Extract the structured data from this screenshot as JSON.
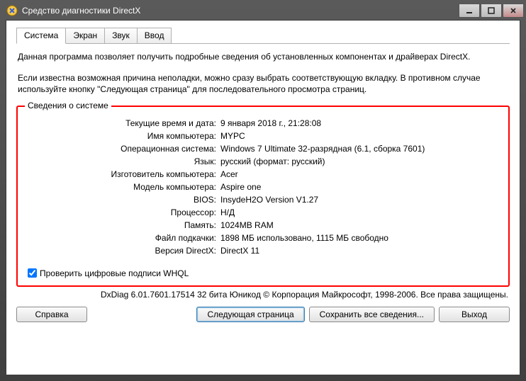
{
  "window": {
    "title": "Средство диагностики DirectX"
  },
  "tabs": [
    "Система",
    "Экран",
    "Звук",
    "Ввод"
  ],
  "intro": {
    "p1": "Данная программа позволяет получить подробные сведения об установленных компонентах и драйверах DirectX.",
    "p2": "Если известна возможная причина неполадки, можно сразу выбрать соответствующую вкладку. В противном случае используйте кнопку \"Следующая страница\" для последовательного просмотра страниц."
  },
  "system_info": {
    "legend": "Сведения о системе",
    "rows": [
      {
        "label": "Текущие время и дата:",
        "value": "9 января 2018 г., 21:28:08"
      },
      {
        "label": "Имя компьютера:",
        "value": "MYPC"
      },
      {
        "label": "Операционная система:",
        "value": "Windows 7 Ultimate 32-разрядная (6.1, сборка 7601)"
      },
      {
        "label": "Язык:",
        "value": "русский (формат: русский)"
      },
      {
        "label": "Изготовитель компьютера:",
        "value": "Acer"
      },
      {
        "label": "Модель компьютера:",
        "value": "Aspire one"
      },
      {
        "label": "BIOS:",
        "value": "InsydeH2O Version V1.27"
      },
      {
        "label": "Процессор:",
        "value": "Н/Д"
      },
      {
        "label": "Память:",
        "value": "1024MB RAM"
      },
      {
        "label": "Файл подкачки:",
        "value": "1898 МБ использовано, 1115 МБ свободно"
      },
      {
        "label": "Версия DirectX:",
        "value": "DirectX 11"
      }
    ],
    "whql_label": "Проверить цифровые подписи WHQL"
  },
  "footer": "DxDiag 6.01.7601.17514 32 бита Юникод  © Корпорация Майкрософт, 1998-2006.  Все права защищены.",
  "buttons": {
    "help": "Справка",
    "next": "Следующая страница",
    "save": "Сохранить все сведения...",
    "exit": "Выход"
  }
}
